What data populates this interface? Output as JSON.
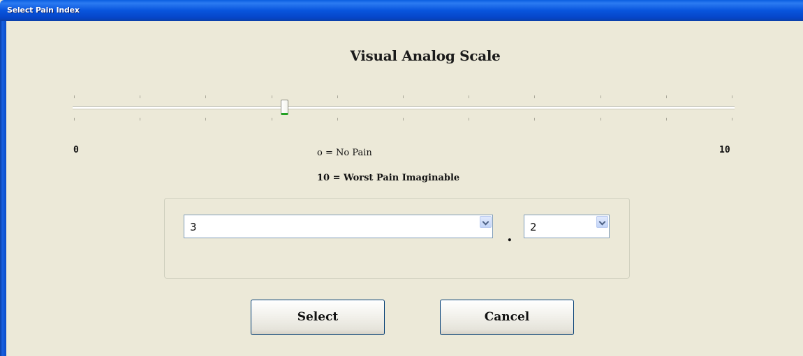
{
  "window": {
    "title": "Select Pain Index"
  },
  "scale": {
    "heading": "Visual Analog Scale",
    "min_label": "0",
    "max_label": "10",
    "legend_min": "o = No Pain",
    "legend_max": "10 = Worst Pain Imaginable",
    "min": 0,
    "max": 10,
    "value": 3.2
  },
  "selectors": {
    "integer_value": "3",
    "decimal_separator": ".",
    "decimal_value": "2"
  },
  "buttons": {
    "select_label": "Select",
    "cancel_label": "Cancel"
  },
  "colors": {
    "title_bar": "#0A5FE0",
    "window_bg": "#ECE9D8",
    "thumb_accent": "#21A121",
    "button_border": "#003C74"
  }
}
